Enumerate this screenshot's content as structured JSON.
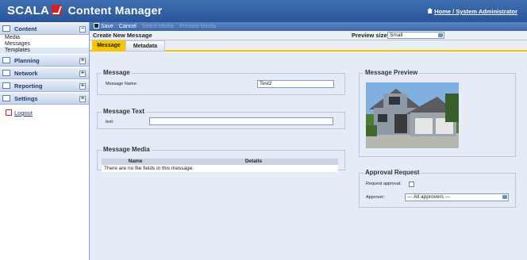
{
  "header": {
    "logo": "SCALA",
    "app_name": "Content Manager",
    "home_link": "Home",
    "separator": "/",
    "user": "System Administrator"
  },
  "sidebar": {
    "sections": [
      {
        "label": "Content",
        "items": [
          "Media",
          "Messages",
          "Templates"
        ],
        "selected": "Templates"
      },
      {
        "label": "Planning"
      },
      {
        "label": "Network"
      },
      {
        "label": "Reporting"
      },
      {
        "label": "Settings"
      }
    ],
    "logout": "Logout"
  },
  "toolbar": {
    "save": "Save",
    "cancel": "Cancel",
    "select_media": "Select Media",
    "preview_media": "Preview Media"
  },
  "page": {
    "title": "Create New Message",
    "preview_size_label": "Preview size:",
    "preview_size_value": "Small"
  },
  "tabs": {
    "message": "Message",
    "metadata": "Metadata"
  },
  "message": {
    "legend": "Message",
    "name_label": "Message Name:",
    "name_value": "Test2"
  },
  "message_text": {
    "legend": "Message Text",
    "text_label": "text:",
    "text_value": ""
  },
  "message_media": {
    "legend": "Message Media",
    "col_name": "Name",
    "col_details": "Details",
    "empty": "There are no file fields in this message."
  },
  "preview": {
    "legend": "Message Preview"
  },
  "approval": {
    "legend": "Approval Request",
    "request_label": "Request approval:",
    "approver_label": "Approver:",
    "approver_value": "--- All approvers ---"
  },
  "colors": {
    "header": "#3f6fb2",
    "accent": "#f7c600",
    "panel": "#e6ecf7"
  }
}
